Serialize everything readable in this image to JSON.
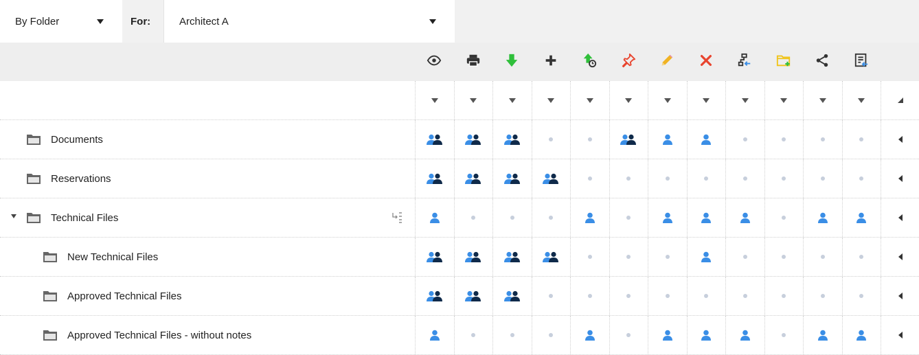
{
  "filters": {
    "mode_label": "By Folder",
    "for_label": "For:",
    "user_label": "Architect A"
  },
  "toolbar": [
    {
      "name": "view-icon",
      "color": "#333333"
    },
    {
      "name": "print-icon",
      "color": "#333333"
    },
    {
      "name": "download-icon",
      "color": "#2fbf3a"
    },
    {
      "name": "add-icon",
      "color": "#333333"
    },
    {
      "name": "upload-version-icon",
      "color": "#2fbf3a"
    },
    {
      "name": "pin-icon",
      "color": "#e8442e"
    },
    {
      "name": "edit-icon",
      "color": "#f0b323"
    },
    {
      "name": "delete-icon",
      "color": "#e8442e"
    },
    {
      "name": "workflow-icon",
      "color": "#333333"
    },
    {
      "name": "new-folder-icon",
      "color": "#f0c419"
    },
    {
      "name": "share-icon",
      "color": "#333333"
    },
    {
      "name": "form-icon",
      "color": "#333333"
    }
  ],
  "colors": {
    "group_light": "#3a8ee6",
    "group_dark": "#0f2a4a",
    "single": "#3a8ee6",
    "none": "#c7cfdc"
  },
  "rows": [
    {
      "label": "Documents",
      "indent": 0,
      "expanded": null,
      "perms": [
        "group",
        "group",
        "group",
        "none",
        "none",
        "group",
        "user",
        "user",
        "none",
        "none",
        "none",
        "none"
      ]
    },
    {
      "label": "Reservations",
      "indent": 0,
      "expanded": null,
      "perms": [
        "group",
        "group",
        "group",
        "group",
        "none",
        "none",
        "none",
        "none",
        "none",
        "none",
        "none",
        "none"
      ]
    },
    {
      "label": "Technical Files",
      "indent": 0,
      "expanded": true,
      "perms": [
        "user",
        "none",
        "none",
        "none",
        "user",
        "none",
        "user",
        "user",
        "user",
        "none",
        "user",
        "user"
      ]
    },
    {
      "label": "New Technical Files",
      "indent": 1,
      "expanded": null,
      "perms": [
        "group",
        "group",
        "group",
        "group",
        "none",
        "none",
        "none",
        "user",
        "none",
        "none",
        "none",
        "none"
      ]
    },
    {
      "label": "Approved Technical Files",
      "indent": 1,
      "expanded": null,
      "perms": [
        "group",
        "group",
        "group",
        "none",
        "none",
        "none",
        "none",
        "none",
        "none",
        "none",
        "none",
        "none"
      ]
    },
    {
      "label": "Approved Technical Files - without notes",
      "indent": 1,
      "expanded": null,
      "perms": [
        "user",
        "none",
        "none",
        "none",
        "user",
        "none",
        "user",
        "user",
        "user",
        "none",
        "user",
        "user"
      ]
    }
  ]
}
